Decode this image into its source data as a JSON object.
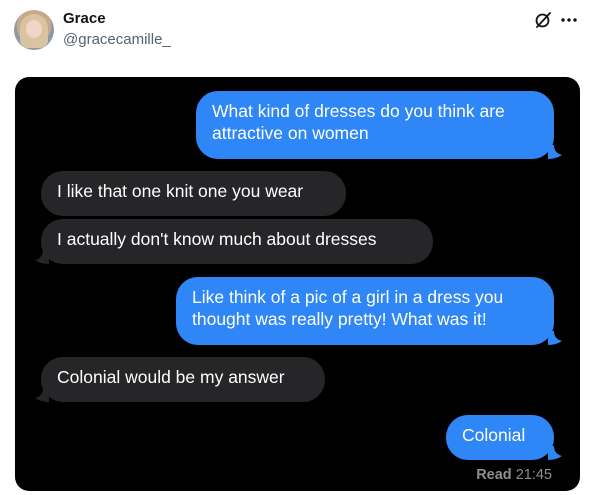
{
  "post": {
    "author_name": "Grace",
    "author_handle": "@gracecamille_",
    "header_icons": [
      "grok-icon",
      "more-icon"
    ]
  },
  "conversation": {
    "messages": [
      {
        "sender": "me",
        "text": "What kind of dresses do you think are attractive on women"
      },
      {
        "sender": "them",
        "text": "I like that one knit one you wear"
      },
      {
        "sender": "them",
        "text": "I actually don't know much about dresses"
      },
      {
        "sender": "me",
        "text": "Like think of a pic of a girl in a dress you thought was really pretty! What was it!"
      },
      {
        "sender": "them",
        "text": "Colonial would be my answer"
      },
      {
        "sender": "me",
        "text": "Colonial"
      }
    ],
    "receipt": {
      "label": "Read",
      "time": "21:45"
    }
  },
  "colors": {
    "sent_bubble": "#2f86f6",
    "received_bubble": "#262628",
    "chat_background": "#000000",
    "receipt_text": "#8e8e93"
  }
}
